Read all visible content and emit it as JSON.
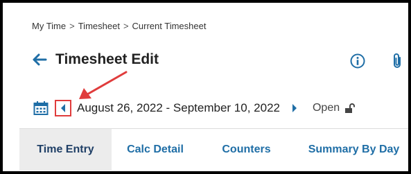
{
  "breadcrumb": {
    "items": [
      "My Time",
      "Timesheet",
      "Current Timesheet"
    ],
    "separator": ">"
  },
  "header": {
    "title": "Timesheet Edit",
    "back_icon": "arrow-left-icon",
    "info_icon": "info-circle-icon",
    "attachment_icon": "paperclip-icon"
  },
  "period": {
    "date_range": "August 26, 2022 - September 10, 2022",
    "status": "Open",
    "calendar_icon": "calendar-icon",
    "prev_icon": "caret-left-icon",
    "next_icon": "caret-right-icon",
    "lock_icon": "unlocked-padlock-icon"
  },
  "tabs": [
    {
      "label": "Time Entry",
      "active": true
    },
    {
      "label": "Calc Detail",
      "active": false
    },
    {
      "label": "Counters",
      "active": false
    },
    {
      "label": "Summary By Day",
      "active": false
    }
  ],
  "colors": {
    "accent": "#1f6ea6",
    "annotation": "#e03c3c",
    "active_tab_bg": "#ececec"
  }
}
